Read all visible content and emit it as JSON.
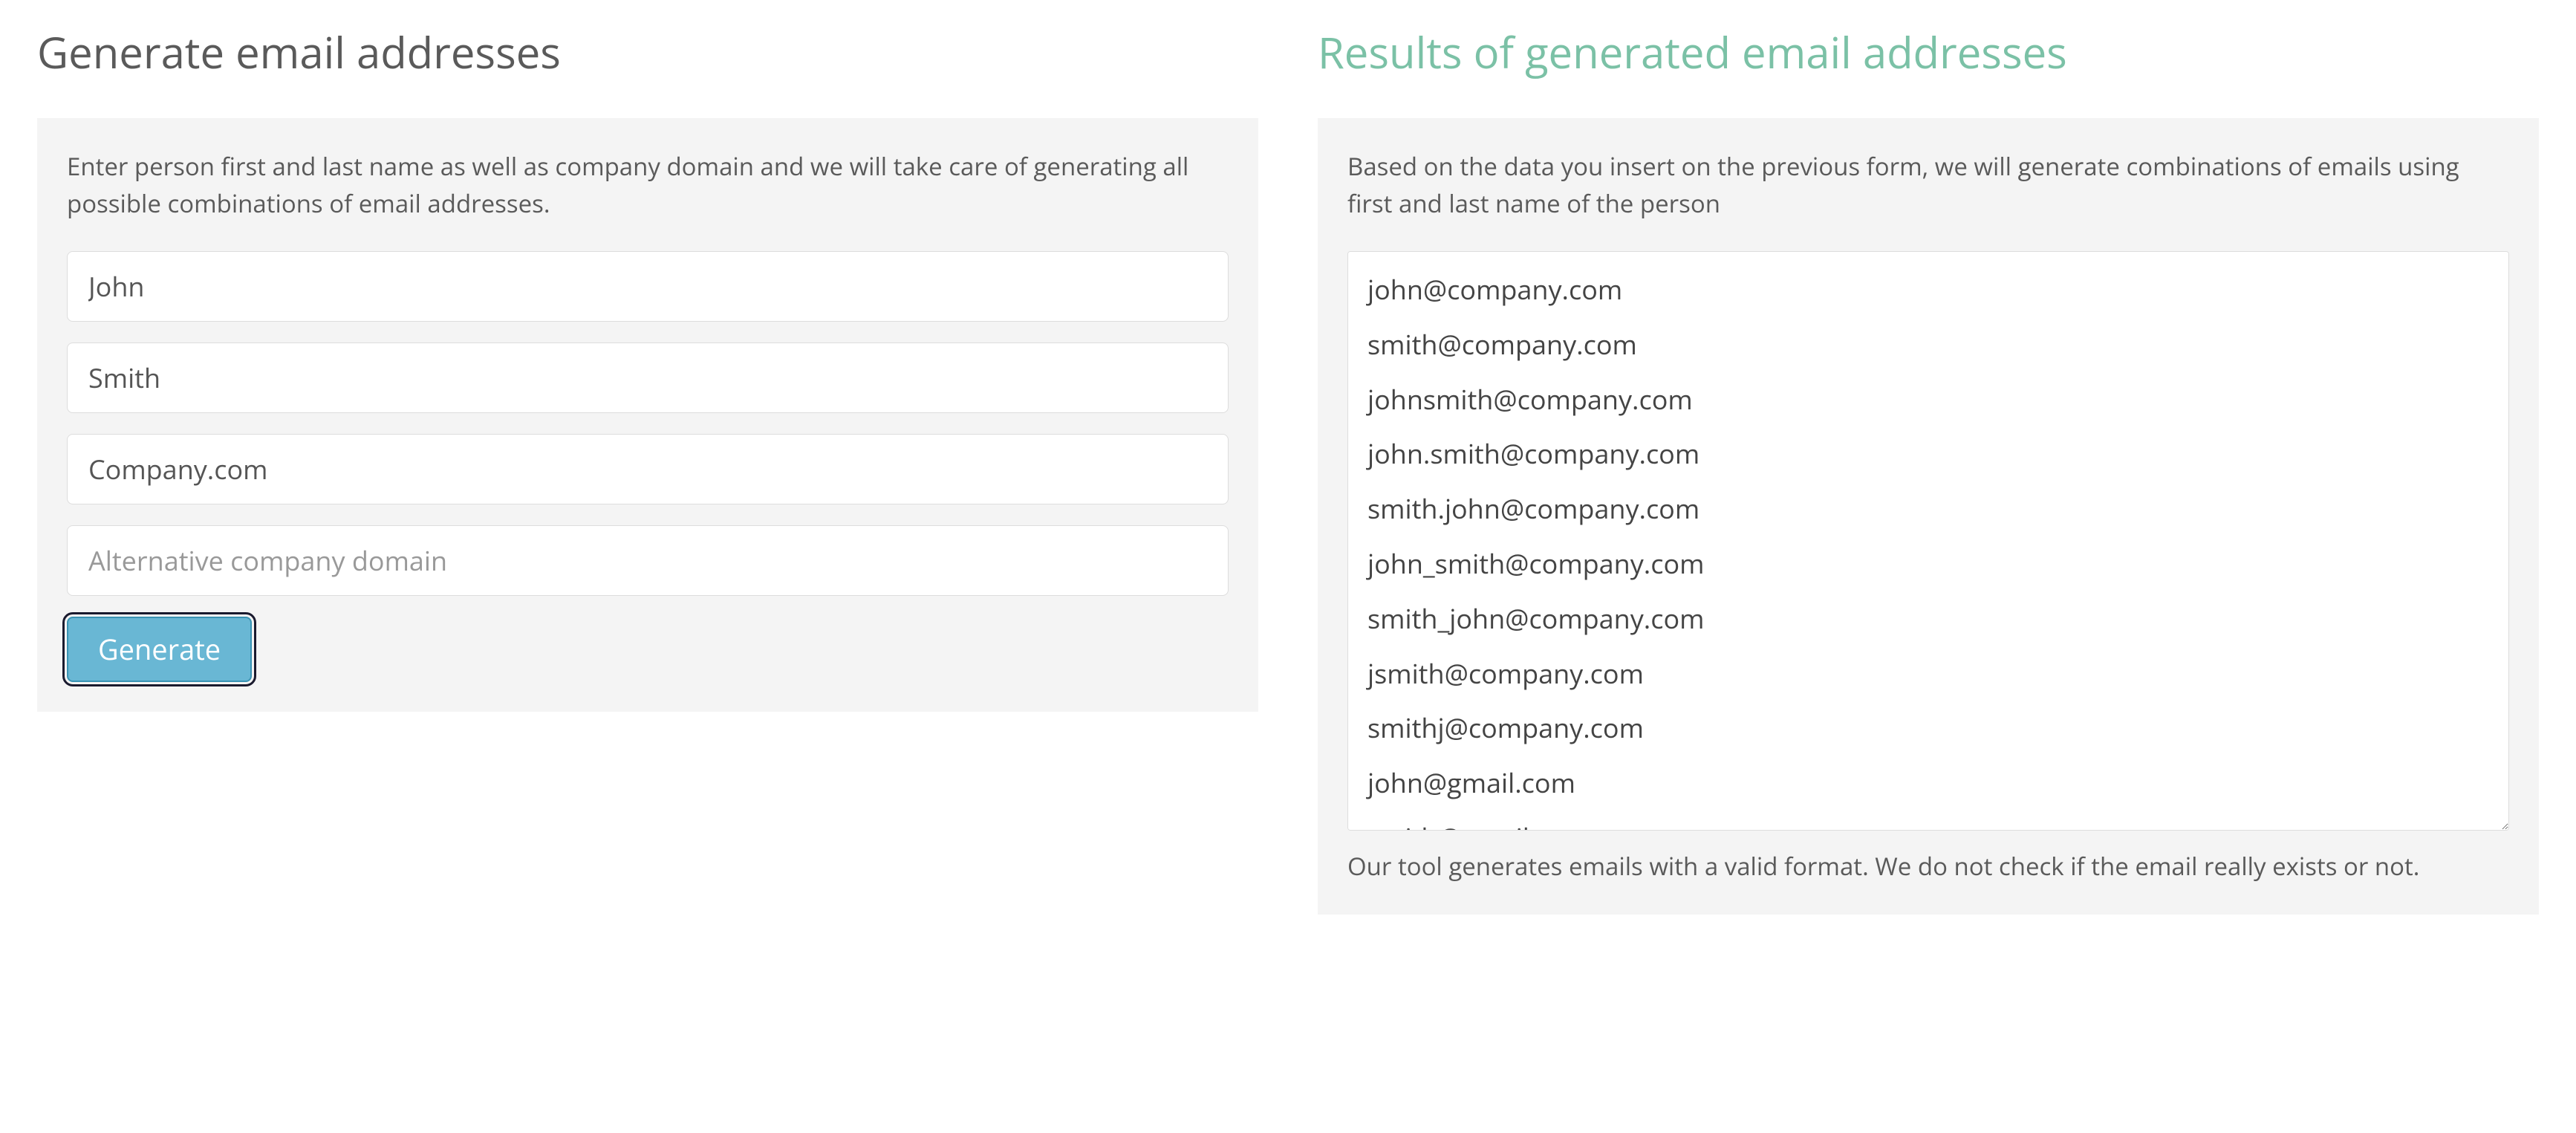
{
  "left": {
    "heading": "Generate email addresses",
    "description": "Enter person first and last name as well as company domain and we will take care of generating all possible combinations of email addresses.",
    "first_name": "John",
    "last_name": "Smith",
    "domain": "Company.com",
    "alt_domain": "",
    "alt_domain_placeholder": "Alternative company domain",
    "button_label": "Generate"
  },
  "right": {
    "heading": "Results of generated email addresses",
    "description": "Based on the data you insert on the previous form, we will generate combinations of emails using first and last name of the person",
    "results": "john@company.com\nsmith@company.com\njohnsmith@company.com\njohn.smith@company.com\nsmith.john@company.com\njohn_smith@company.com\nsmith_john@company.com\njsmith@company.com\nsmithj@company.com\njohn@gmail.com\nsmith@gmail.com",
    "footnote": "Our tool generates emails with a valid format. We do not check if the email really exists or not."
  }
}
